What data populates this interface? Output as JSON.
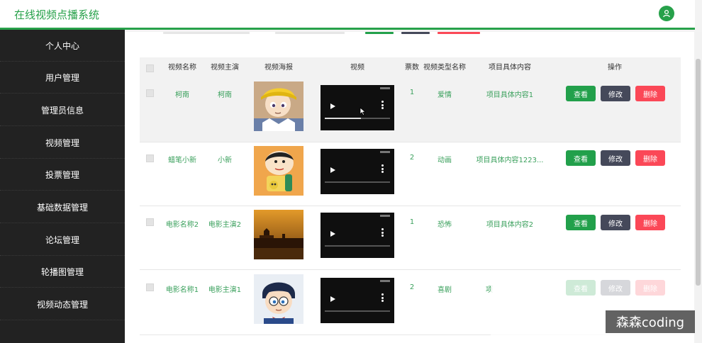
{
  "app": {
    "title": "在线视频点播系统"
  },
  "sidebar": {
    "items": [
      {
        "label": "个人中心"
      },
      {
        "label": "用户管理"
      },
      {
        "label": "管理员信息"
      },
      {
        "label": "视频管理"
      },
      {
        "label": "投票管理"
      },
      {
        "label": "基础数据管理"
      },
      {
        "label": "论坛管理"
      },
      {
        "label": "轮播图管理"
      },
      {
        "label": "视频动态管理"
      }
    ]
  },
  "table": {
    "headers": {
      "name": "视频名称",
      "actor": "视频主演",
      "poster": "视频海报",
      "video": "视频",
      "votes": "票数",
      "type": "视频类型名称",
      "content": "项目具体内容",
      "ops": "操作"
    },
    "rows": [
      {
        "name": "柯南",
        "actor": "柯南",
        "votes": "1",
        "type": "爱情",
        "content": "项目具体内容1",
        "progress": 0.55
      },
      {
        "name": "蜡笔小新",
        "actor": "小新",
        "votes": "2",
        "type": "动画",
        "content": "项目具体内容1223...",
        "progress": 0
      },
      {
        "name": "电影名称2",
        "actor": "电影主演2",
        "votes": "1",
        "type": "恐怖",
        "content": "项目具体内容2",
        "progress": 0
      },
      {
        "name": "电影名称1",
        "actor": "电影主演1",
        "votes": "2",
        "type": "喜剧",
        "content": "项",
        "progress": 0
      }
    ],
    "actions": {
      "view": "查看",
      "edit": "修改",
      "delete": "删除"
    }
  },
  "watermark": "森森coding",
  "colors": {
    "accent": "#27a14a",
    "sidebar": "#222222",
    "view": "#22a04b",
    "edit": "#45495a",
    "delete": "#fb4857"
  }
}
